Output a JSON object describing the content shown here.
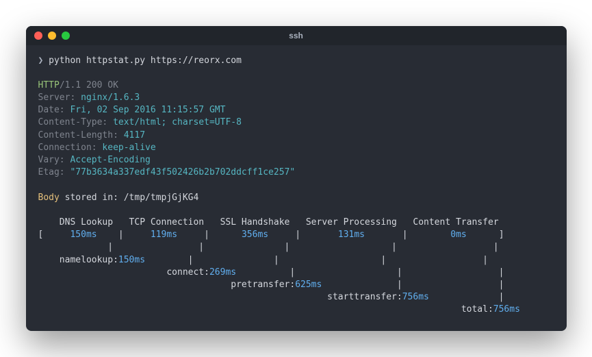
{
  "window": {
    "title": "ssh"
  },
  "prompt": {
    "symbol": "❯",
    "command": "python httpstat.py https://reorx.com"
  },
  "http": {
    "proto": "HTTP",
    "version": "/1.1 200 OK"
  },
  "headers": {
    "server_key": "Server: ",
    "server_val": "nginx/1.6.3",
    "date_key": "Date: ",
    "date_val": "Fri, 02 Sep 2016 11:15:57 GMT",
    "ctype_key": "Content-Type: ",
    "ctype_val": "text/html; charset=UTF-8",
    "clen_key": "Content-Length: ",
    "clen_val": "4117",
    "conn_key": "Connection: ",
    "conn_val": "keep-alive",
    "vary_key": "Vary: ",
    "vary_val": "Accept-Encoding",
    "etag_key": "Etag: ",
    "etag_val": "\"77b3634a337edf43f502426b2b702ddcff1ce257\""
  },
  "body": {
    "label": "Body",
    "text": " stored in: ",
    "path": "/tmp/tmpjGjKG4"
  },
  "timings": {
    "header": "    DNS Lookup   TCP Connection   SSL Handshake   Server Processing   Content Transfer",
    "row_open": "[   ",
    "dns": "  150ms  ",
    "sep": "  |   ",
    "tcp": "  119ms  ",
    "sep2": "   |    ",
    "ssl": "  356ms  ",
    "sep3": "   |     ",
    "srv": "  131ms  ",
    "sep4": "     |      ",
    "ct": "  0ms   ",
    "row_close": "   ]",
    "pipe_row1": "             |                |               |                   |                  |",
    "nl_lbl": "    namelookup:",
    "nl_val": "150ms",
    "nl_tail": "        |               |                   |                  |",
    "cn_pad": "                        ",
    "cn_lbl": "connect:",
    "cn_val": "269ms",
    "cn_tail": "          |                   |                  |",
    "pt_pad": "                                    ",
    "pt_lbl": "pretransfer:",
    "pt_val": "625ms",
    "pt_tail": "              |                  |",
    "st_pad": "                                                      ",
    "st_lbl": "starttransfer:",
    "st_val": "756ms",
    "st_tail": "             |",
    "to_pad": "                                                                               ",
    "to_lbl": "total:",
    "to_val": "756ms"
  }
}
